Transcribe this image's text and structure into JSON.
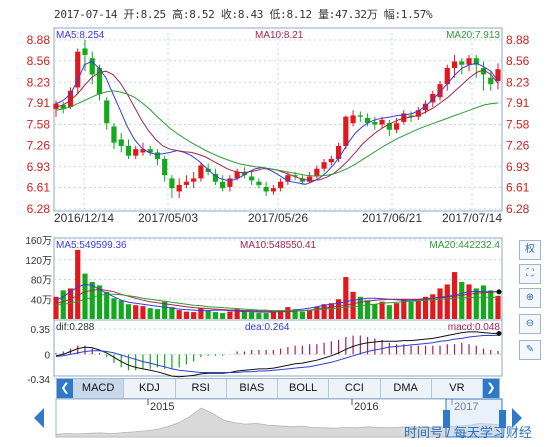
{
  "header": {
    "text": "2017-07-14 开:8.25 高:8.52 收:8.43 低:8.12 量:47.32万 幅:1.57%"
  },
  "ma_labels": {
    "ma5": "MA5:8.254",
    "ma10": "MA10:8.21",
    "ma20": "MA20:7.913"
  },
  "vol_labels": {
    "ma5": "MA5:549599.36",
    "ma10": "MA10:548550.41",
    "ma20": "MA20:442232.4"
  },
  "macd_labels": {
    "dif": "dif:0.288",
    "dea": "dea:0.264",
    "macd": "macd:0.048"
  },
  "tabs": [
    "MACD",
    "KDJ",
    "RSI",
    "BIAS",
    "BOLL",
    "CCI",
    "DMA",
    "VR"
  ],
  "active_tab": "MACD",
  "tools": [
    "权",
    "⛶",
    "⊕",
    "⊖",
    "✎"
  ],
  "watermark": "时间号 / 每天学习财经",
  "colors": {
    "up": "#e0191d",
    "down": "#12a91c",
    "ma5": "#3a3ae0",
    "ma10": "#a22550",
    "ma20": "#2f9b36",
    "grid": "#c9d6e6",
    "axis": "#d02020"
  },
  "chart_data": [
    {
      "type": "candlestick",
      "title": "",
      "price_ticks": [
        "8.88",
        "8.56",
        "8.23",
        "7.91",
        "7.58",
        "7.26",
        "6.93",
        "6.61",
        "6.28"
      ],
      "ylim": [
        6.28,
        8.88
      ],
      "x_ticks": [
        "2016/12/14",
        "2017/05/03",
        "2017/05/26",
        "2017/06/21",
        "2017/07/14"
      ],
      "series": [
        {
          "name": "MA5",
          "values": [
            7.9,
            7.95,
            8.05,
            8.25,
            8.5,
            8.55,
            8.45,
            8.3,
            8.05,
            7.8,
            7.55,
            7.35,
            7.22,
            7.15,
            7.12,
            7.13,
            7.15,
            7.18,
            7.15,
            7.1,
            7.02,
            6.92,
            6.82,
            6.75,
            6.72,
            6.73,
            6.78,
            6.85,
            6.9,
            6.92,
            6.88,
            6.82,
            6.75,
            6.7,
            6.68,
            6.66,
            6.7,
            6.76,
            6.85,
            6.97,
            7.12,
            7.3,
            7.45,
            7.55,
            7.62,
            7.66,
            7.68,
            7.7,
            7.72,
            7.73,
            7.75,
            7.8,
            7.88,
            7.98,
            8.1,
            8.22,
            8.35,
            8.45,
            8.5,
            8.52,
            8.47,
            8.4,
            8.25
          ]
        },
        {
          "name": "MA10",
          "values": [
            7.85,
            7.88,
            7.95,
            8.05,
            8.18,
            8.3,
            8.38,
            8.4,
            8.35,
            8.22,
            8.05,
            7.85,
            7.65,
            7.48,
            7.35,
            7.25,
            7.2,
            7.18,
            7.16,
            7.15,
            7.12,
            7.08,
            7.02,
            6.96,
            6.9,
            6.86,
            6.84,
            6.85,
            6.87,
            6.9,
            6.9,
            6.88,
            6.84,
            6.8,
            6.76,
            6.73,
            6.72,
            6.73,
            6.77,
            6.83,
            6.92,
            7.03,
            7.15,
            7.28,
            7.38,
            7.47,
            7.54,
            7.6,
            7.65,
            7.68,
            7.7,
            7.73,
            7.78,
            7.84,
            7.92,
            8.0,
            8.1,
            8.2,
            8.3,
            8.38,
            8.42,
            8.35,
            8.21
          ]
        },
        {
          "name": "MA20",
          "values": [
            7.8,
            7.82,
            7.85,
            7.9,
            7.95,
            8.0,
            8.05,
            8.08,
            8.1,
            8.08,
            8.05,
            8.0,
            7.92,
            7.83,
            7.72,
            7.62,
            7.52,
            7.44,
            7.37,
            7.3,
            7.24,
            7.18,
            7.13,
            7.08,
            7.04,
            7.0,
            6.97,
            6.95,
            6.93,
            6.92,
            6.9,
            6.88,
            6.86,
            6.84,
            6.82,
            6.8,
            6.79,
            6.79,
            6.8,
            6.82,
            6.86,
            6.91,
            6.97,
            7.04,
            7.11,
            7.18,
            7.25,
            7.31,
            7.37,
            7.42,
            7.47,
            7.52,
            7.56,
            7.6,
            7.64,
            7.68,
            7.72,
            7.76,
            7.8,
            7.84,
            7.88,
            7.9,
            7.913
          ]
        }
      ],
      "candles": [
        [
          7.82,
          7.9,
          7.7,
          7.95
        ],
        [
          7.88,
          7.82,
          7.75,
          7.93
        ],
        [
          7.85,
          8.1,
          7.82,
          8.15
        ],
        [
          8.15,
          8.7,
          8.05,
          8.75
        ],
        [
          8.75,
          8.65,
          8.4,
          8.88
        ],
        [
          8.6,
          8.35,
          8.2,
          8.7
        ],
        [
          8.45,
          8.05,
          7.95,
          8.5
        ],
        [
          7.95,
          7.6,
          7.5,
          8.0
        ],
        [
          7.55,
          7.3,
          7.2,
          7.6
        ],
        [
          7.35,
          7.25,
          7.15,
          7.45
        ],
        [
          7.25,
          7.1,
          7.05,
          7.35
        ],
        [
          7.1,
          7.2,
          7.05,
          7.25
        ],
        [
          7.15,
          7.2,
          7.1,
          7.3
        ],
        [
          7.2,
          7.15,
          7.1,
          7.25
        ],
        [
          7.15,
          7.05,
          6.95,
          7.2
        ],
        [
          7.05,
          6.8,
          6.7,
          7.1
        ],
        [
          6.75,
          6.6,
          6.45,
          6.8
        ],
        [
          6.55,
          6.65,
          6.45,
          6.75
        ],
        [
          6.65,
          6.7,
          6.6,
          6.8
        ],
        [
          6.7,
          6.75,
          6.6,
          6.85
        ],
        [
          6.75,
          6.95,
          6.7,
          7.0
        ],
        [
          6.9,
          6.85,
          6.8,
          6.98
        ],
        [
          6.82,
          6.7,
          6.65,
          6.9
        ],
        [
          6.7,
          6.6,
          6.55,
          6.8
        ],
        [
          6.62,
          6.75,
          6.55,
          6.8
        ],
        [
          6.75,
          6.85,
          6.72,
          6.9
        ],
        [
          6.85,
          6.8,
          6.75,
          6.92
        ],
        [
          6.78,
          6.72,
          6.65,
          6.85
        ],
        [
          6.7,
          6.65,
          6.6,
          6.75
        ],
        [
          6.62,
          6.55,
          6.48,
          6.7
        ],
        [
          6.55,
          6.6,
          6.5,
          6.65
        ],
        [
          6.6,
          6.7,
          6.55,
          6.75
        ],
        [
          6.7,
          6.8,
          6.65,
          6.85
        ],
        [
          6.8,
          6.78,
          6.72,
          6.85
        ],
        [
          6.75,
          6.7,
          6.65,
          6.8
        ],
        [
          6.7,
          6.78,
          6.68,
          6.85
        ],
        [
          6.78,
          6.9,
          6.75,
          6.95
        ],
        [
          6.9,
          7.0,
          6.85,
          7.05
        ],
        [
          7.0,
          7.05,
          6.95,
          7.1
        ],
        [
          7.05,
          7.25,
          7.0,
          7.3
        ],
        [
          7.25,
          7.7,
          7.2,
          7.72
        ],
        [
          7.6,
          7.72,
          7.55,
          7.8
        ],
        [
          7.72,
          7.7,
          7.62,
          7.78
        ],
        [
          7.68,
          7.6,
          7.55,
          7.75
        ],
        [
          7.62,
          7.58,
          7.5,
          7.7
        ],
        [
          7.58,
          7.65,
          7.52,
          7.7
        ],
        [
          7.6,
          7.5,
          7.4,
          7.65
        ],
        [
          7.5,
          7.6,
          7.45,
          7.68
        ],
        [
          7.62,
          7.75,
          7.58,
          7.8
        ],
        [
          7.72,
          7.7,
          7.62,
          7.78
        ],
        [
          7.7,
          7.8,
          7.65,
          7.85
        ],
        [
          7.8,
          7.9,
          7.75,
          7.95
        ],
        [
          7.92,
          8.05,
          7.85,
          8.1
        ],
        [
          8.0,
          8.2,
          7.95,
          8.25
        ],
        [
          8.2,
          8.45,
          8.1,
          8.5
        ],
        [
          8.45,
          8.55,
          8.3,
          8.65
        ],
        [
          8.55,
          8.5,
          8.35,
          8.6
        ],
        [
          8.5,
          8.6,
          8.4,
          8.65
        ],
        [
          8.6,
          8.5,
          8.3,
          8.65
        ],
        [
          8.45,
          8.35,
          8.1,
          8.55
        ],
        [
          8.3,
          8.2,
          8.1,
          8.4
        ],
        [
          8.25,
          8.43,
          8.12,
          8.52
        ]
      ]
    },
    {
      "type": "bar",
      "title": "",
      "y_ticks": [
        "160万",
        "120万",
        "80万",
        "40万"
      ],
      "ylim": [
        0,
        160
      ],
      "unit": "万",
      "series": [
        {
          "name": "MA5",
          "values": [
            38,
            45,
            55,
            65,
            70,
            68,
            60,
            52,
            45,
            38,
            34,
            32,
            30,
            28,
            26,
            24,
            22,
            20,
            19,
            18,
            17,
            17,
            18,
            18,
            17,
            16,
            15,
            15,
            14,
            14,
            14,
            15,
            16,
            18,
            20,
            22,
            25,
            28,
            30,
            32,
            35,
            38,
            40,
            42,
            42,
            41,
            40,
            39,
            38,
            38,
            39,
            40,
            42,
            44,
            46,
            48,
            52,
            55,
            56,
            55,
            55,
            55
          ]
        },
        {
          "name": "MA10",
          "values": [
            32,
            35,
            40,
            48,
            55,
            58,
            60,
            58,
            55,
            50,
            46,
            42,
            38,
            35,
            33,
            31,
            29,
            27,
            25,
            23,
            22,
            21,
            20,
            19,
            18,
            18,
            17,
            17,
            16,
            16,
            15,
            15,
            15,
            16,
            17,
            18,
            20,
            22,
            24,
            26,
            28,
            31,
            34,
            36,
            38,
            39,
            40,
            40,
            40,
            40,
            40,
            41,
            42,
            43,
            44,
            46,
            48,
            50,
            52,
            53,
            54,
            55
          ]
        },
        {
          "name": "MA20",
          "values": [
            28,
            30,
            32,
            35,
            40,
            44,
            48,
            50,
            50,
            49,
            47,
            45,
            42,
            40,
            38,
            36,
            34,
            32,
            30,
            28,
            27,
            25,
            24,
            23,
            22,
            21,
            20,
            19,
            18,
            18,
            17,
            17,
            17,
            17,
            17,
            18,
            19,
            20,
            21,
            22,
            24,
            25,
            27,
            29,
            30,
            32,
            33,
            34,
            35,
            36,
            37,
            38,
            39,
            40,
            41,
            42,
            43,
            43,
            44,
            44,
            44,
            44
          ]
        }
      ],
      "volumes": [
        45,
        58,
        62,
        140,
        92,
        75,
        68,
        55,
        42,
        38,
        30,
        28,
        26,
        22,
        20,
        35,
        24,
        18,
        15,
        14,
        22,
        18,
        14,
        12,
        15,
        20,
        16,
        14,
        12,
        12,
        14,
        18,
        24,
        20,
        15,
        18,
        25,
        30,
        32,
        40,
        85,
        55,
        45,
        38,
        30,
        35,
        28,
        32,
        40,
        35,
        38,
        45,
        50,
        62,
        70,
        95,
        75,
        70,
        62,
        68,
        58,
        47
      ]
    },
    {
      "type": "bar",
      "title": "",
      "y_ticks": [
        "0.35",
        "0",
        "-0.34"
      ],
      "ylim": [
        -0.34,
        0.35
      ],
      "series": [
        {
          "name": "DIF",
          "values": [
            -0.02,
            0.0,
            0.04,
            0.08,
            0.1,
            0.09,
            0.06,
            0.02,
            -0.04,
            -0.1,
            -0.15,
            -0.18,
            -0.2,
            -0.22,
            -0.24,
            -0.27,
            -0.3,
            -0.31,
            -0.3,
            -0.29,
            -0.27,
            -0.26,
            -0.26,
            -0.26,
            -0.25,
            -0.23,
            -0.22,
            -0.21,
            -0.2,
            -0.2,
            -0.19,
            -0.17,
            -0.15,
            -0.13,
            -0.12,
            -0.1,
            -0.08,
            -0.05,
            -0.02,
            0.02,
            0.07,
            0.11,
            0.14,
            0.16,
            0.17,
            0.18,
            0.18,
            0.18,
            0.19,
            0.19,
            0.2,
            0.21,
            0.22,
            0.24,
            0.26,
            0.28,
            0.3,
            0.31,
            0.31,
            0.3,
            0.29,
            0.288
          ]
        },
        {
          "name": "DEA",
          "values": [
            -0.03,
            -0.02,
            0.0,
            0.02,
            0.04,
            0.05,
            0.05,
            0.04,
            0.02,
            -0.01,
            -0.04,
            -0.07,
            -0.1,
            -0.12,
            -0.15,
            -0.17,
            -0.2,
            -0.22,
            -0.23,
            -0.24,
            -0.25,
            -0.25,
            -0.25,
            -0.25,
            -0.25,
            -0.25,
            -0.24,
            -0.24,
            -0.23,
            -0.23,
            -0.22,
            -0.21,
            -0.2,
            -0.19,
            -0.18,
            -0.17,
            -0.15,
            -0.13,
            -0.11,
            -0.08,
            -0.05,
            -0.02,
            0.01,
            0.04,
            0.06,
            0.08,
            0.1,
            0.11,
            0.12,
            0.13,
            0.14,
            0.15,
            0.16,
            0.18,
            0.19,
            0.21,
            0.22,
            0.24,
            0.25,
            0.26,
            0.26,
            0.264
          ]
        }
      ],
      "histogram": [
        0.02,
        0.04,
        0.08,
        0.12,
        0.12,
        0.08,
        0.02,
        -0.04,
        -0.12,
        -0.18,
        -0.22,
        -0.22,
        -0.2,
        -0.2,
        -0.18,
        -0.2,
        -0.2,
        -0.18,
        -0.14,
        -0.1,
        -0.04,
        -0.02,
        -0.02,
        -0.02,
        0.0,
        0.04,
        0.04,
        0.06,
        0.06,
        0.06,
        0.06,
        0.08,
        0.1,
        0.12,
        0.12,
        0.14,
        0.14,
        0.16,
        0.18,
        0.2,
        0.24,
        0.26,
        0.26,
        0.24,
        0.22,
        0.2,
        0.16,
        0.14,
        0.14,
        0.12,
        0.12,
        0.12,
        0.12,
        0.12,
        0.14,
        0.14,
        0.16,
        0.14,
        0.12,
        0.08,
        0.06,
        0.048
      ]
    },
    {
      "type": "area",
      "title": "",
      "x_ticks": [
        "2015",
        "2016",
        "2017"
      ],
      "values": [
        0.08,
        0.1,
        0.09,
        0.11,
        0.12,
        0.1,
        0.13,
        0.15,
        0.18,
        0.22,
        0.3,
        0.42,
        0.6,
        0.85,
        0.7,
        0.5,
        0.42,
        0.38,
        0.4,
        0.35,
        0.33,
        0.3,
        0.32,
        0.28,
        0.27,
        0.26,
        0.28,
        0.27,
        0.3,
        0.28,
        0.27,
        0.29,
        0.3,
        0.28,
        0.27,
        0.3,
        0.32,
        0.34,
        0.4,
        0.38,
        0.36
      ]
    }
  ]
}
